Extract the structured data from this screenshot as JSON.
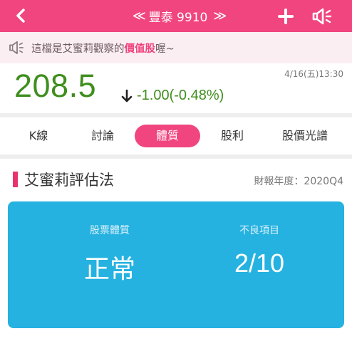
{
  "header": {
    "title": "豐泰 9910",
    "prev_glyph": "≪",
    "next_glyph": "≫",
    "icons": [
      "back-chevron-icon",
      "prev-stock-icon",
      "next-stock-icon",
      "plus-icon",
      "speaker-icon"
    ]
  },
  "notice": {
    "prefix": "這檔是艾蜜莉觀察的",
    "highlight": "價值股",
    "suffix": "喔~"
  },
  "quote": {
    "price": "208.5",
    "change": "-1.00(-0.48%)",
    "timestamp": "4/16(五)13:30"
  },
  "tabs": [
    {
      "label": "K線",
      "active": false
    },
    {
      "label": "討論",
      "active": false
    },
    {
      "label": "體質",
      "active": true
    },
    {
      "label": "股利",
      "active": false
    },
    {
      "label": "股價光譜",
      "active": false
    }
  ],
  "section": {
    "title": "艾蜜莉評估法",
    "report_year": "財報年度：2020Q4"
  },
  "summary": {
    "health_label": "股票體質",
    "health_value": "正常",
    "bad_items_label": "不良項目",
    "bad_items_value": "2/10"
  },
  "colors": {
    "brand": "#f0457f",
    "price_green": "#3f8e1e",
    "card_blue": "#25b2e0"
  }
}
